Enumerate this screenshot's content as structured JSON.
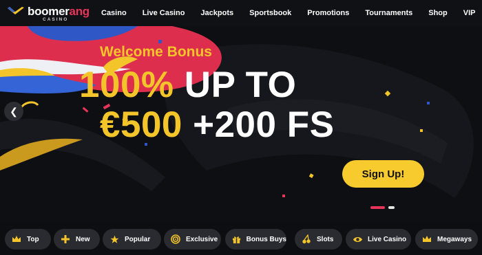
{
  "brand": {
    "name_a": "boomer",
    "name_b": "ang",
    "sub": "CASINO",
    "color": "#e8345a"
  },
  "nav": {
    "items": [
      "Casino",
      "Live Casino",
      "Jackpots",
      "Sportsbook",
      "Promotions",
      "Tournaments",
      "Shop",
      "VIP"
    ]
  },
  "hero": {
    "welcome": "Welcome Bonus",
    "line1_a": "100%",
    "line1_b": " UP TO",
    "line2_a": "€500",
    "line2_b": " +200 FS",
    "cta": "Sign Up!",
    "prev_icon": "chevron-left-icon",
    "slides": 2,
    "active_slide": 1,
    "accent": "#f4c52a"
  },
  "categories": [
    {
      "label": "Top",
      "icon": "crown-icon"
    },
    {
      "label": "New",
      "icon": "plus-icon"
    },
    {
      "label": "Popular",
      "icon": "star-icon"
    },
    {
      "label": "Exclusive",
      "icon": "target-icon"
    },
    {
      "label": "Bonus Buys",
      "icon": "gift-icon"
    },
    {
      "label": "Slots",
      "icon": "cherries-icon"
    },
    {
      "label": "Live Casino",
      "icon": "eye-icon"
    },
    {
      "label": "Megaways",
      "icon": "crown-icon"
    }
  ]
}
